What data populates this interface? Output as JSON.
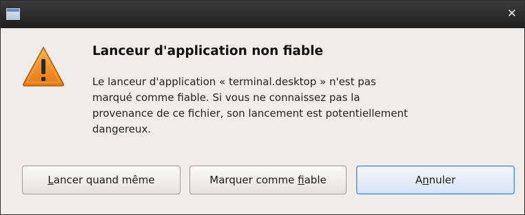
{
  "window": {
    "title": "",
    "close_glyph": "✕"
  },
  "icon": "warning-triangle-icon",
  "dialog": {
    "title": "Lanceur d'application non fiable",
    "message_lines": [
      "Le lanceur d'application « terminal.desktop » n'est pas",
      "marqué comme fiable. Si vous ne connaissez pas la",
      "provenance de ce fichier, son lancement est potentiellement",
      "dangereux."
    ]
  },
  "buttons": {
    "run": {
      "pre": "",
      "mnemonic": "L",
      "post": "ancer quand même"
    },
    "trust": {
      "pre": "Marquer comme ",
      "mnemonic": "f",
      "post": "iable"
    },
    "cancel": {
      "pre": "A",
      "mnemonic": "n",
      "post": "nuler"
    }
  },
  "colors": {
    "titlebar": "#2e2e2e",
    "dialog_bg": "#eeedeb",
    "warning_orange": "#f08a1e",
    "default_button_border": "#4a90d9"
  }
}
